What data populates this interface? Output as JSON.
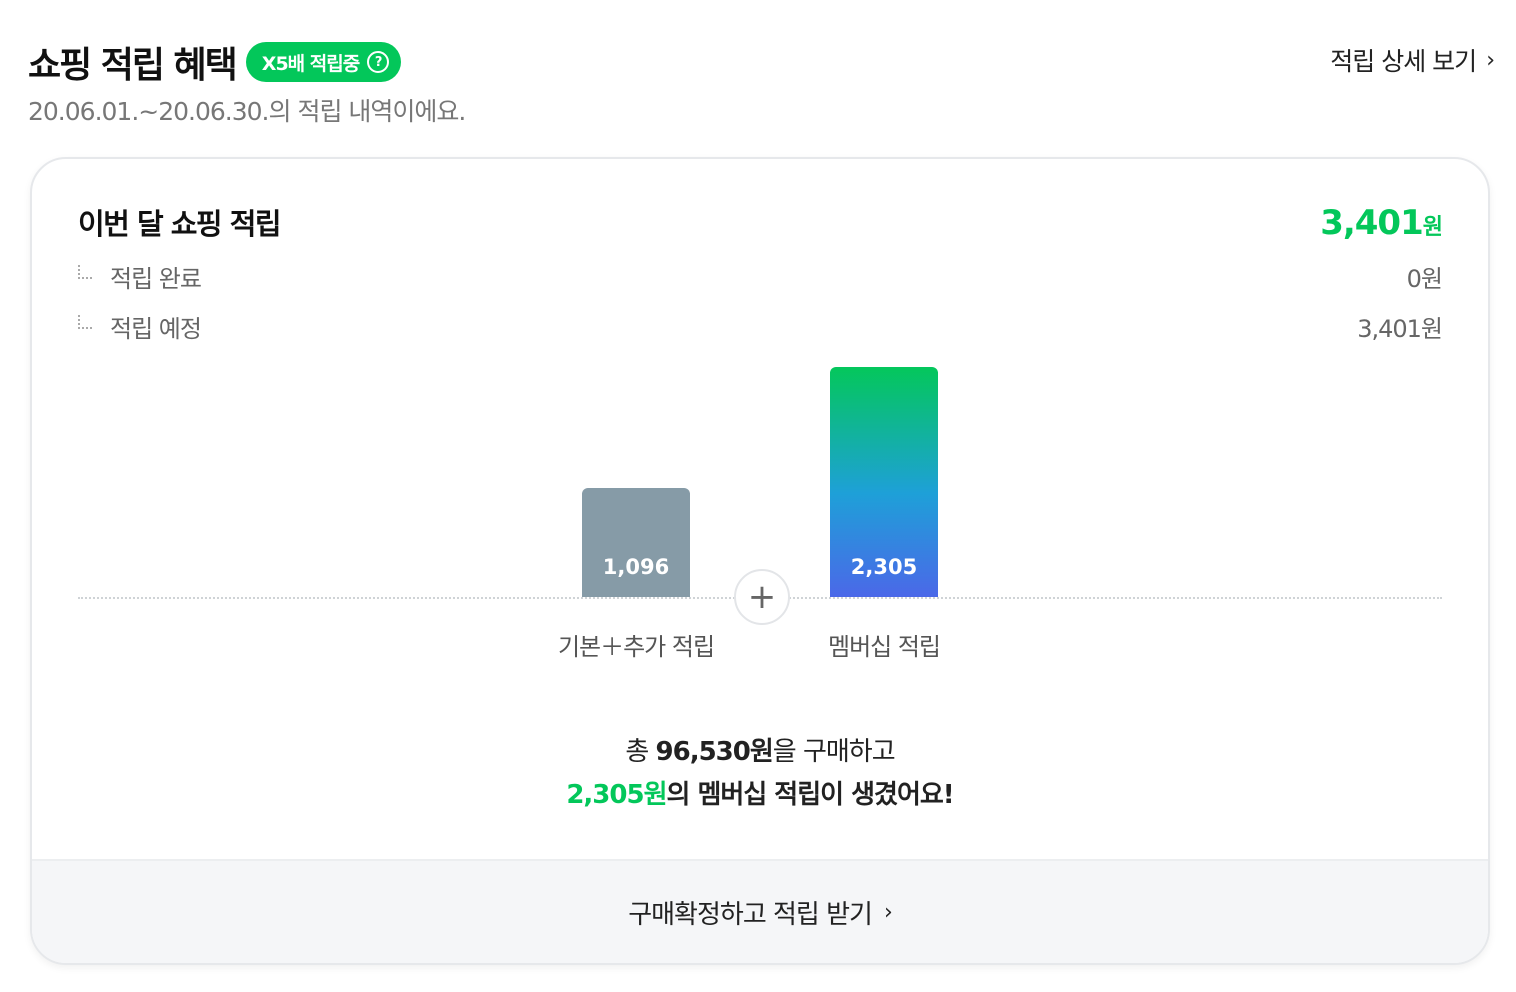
{
  "header": {
    "title": "쇼핑 적립 혜택",
    "badge_label": "X5배 적립중",
    "badge_help_icon": "?",
    "detail_link": "적립 상세 보기",
    "period_text": "20.06.01.~20.06.30.의 적립 내역이에요."
  },
  "card": {
    "main_label": "이번 달 쇼핑 적립",
    "main_amount": "3,401",
    "main_unit": "원",
    "rows": [
      {
        "label": "적립 완료",
        "value": "0원"
      },
      {
        "label": "적립 예정",
        "value": "3,401원"
      }
    ],
    "chart": {
      "bars": [
        {
          "label": "기본＋추가 적립",
          "value_text": "1,096"
        },
        {
          "label": "멤버십 적립",
          "value_text": "2,305"
        }
      ],
      "plus": "+"
    },
    "summary": {
      "line1_prefix": "총 ",
      "line1_amount": "96,530원",
      "line1_suffix": "을 구매하고",
      "line2_amount": "2,305원",
      "line2_suffix": "의 멤버십 적립이 생겼어요!"
    },
    "footer_button": "구매확정하고 적립 받기"
  },
  "chart_data": {
    "type": "bar",
    "categories": [
      "기본＋추가 적립",
      "멤버십 적립"
    ],
    "values": [
      1096,
      2305
    ]
  },
  "colors": {
    "accent": "#03c75a",
    "bar_gray": "#869ba7",
    "bar_gradient_end": "#4b68e8"
  }
}
